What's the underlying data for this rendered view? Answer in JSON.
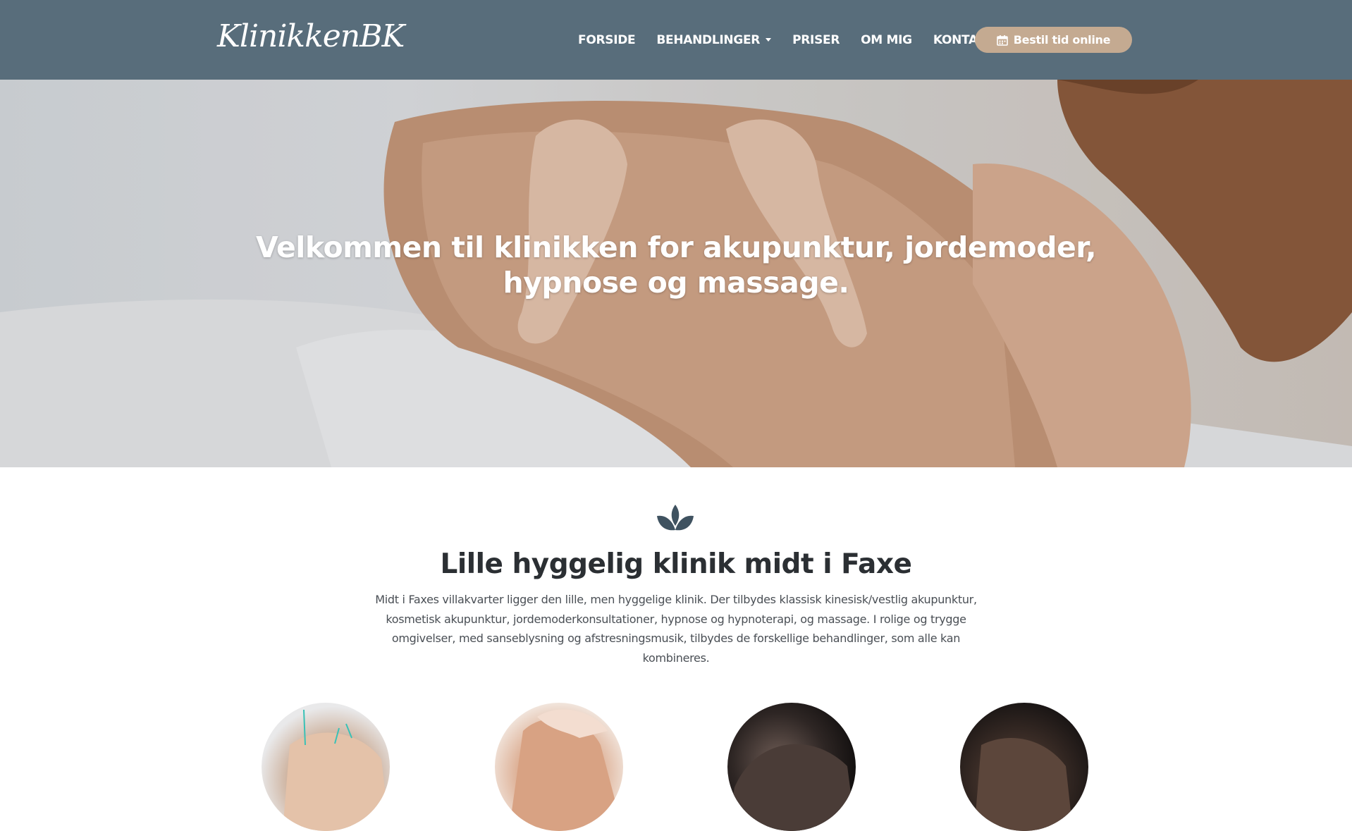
{
  "brand": {
    "logo_text": "KlinikkenBK"
  },
  "nav": {
    "items": [
      {
        "label": "FORSIDE"
      },
      {
        "label": "BEHANDLINGER",
        "has_dropdown": true
      },
      {
        "label": "PRISER"
      },
      {
        "label": "OM MIG"
      },
      {
        "label": "KONTAKT"
      }
    ],
    "cta_label": "Bestil tid online",
    "cta_icon": "calendar-icon"
  },
  "hero": {
    "title": "Velkommen til klinikken for akupunktur, jordemoder, hypnose og massage."
  },
  "intro": {
    "icon": "lotus-icon",
    "heading": "Lille hyggelig klinik midt i Faxe",
    "text": "Midt i Faxes villakvarter ligger den lille, men hyggelige klinik. Der tilbydes klassisk kinesisk/vestlig akupunktur, kosmetisk akupunktur, jordemoderkonsultationer, hypnose og hypnoterapi, og massage. I rolige og trygge omgivelser, med sanseblysning og afstresningsmusik, tilbydes de forskellige behandlinger, som alle kan kombineres."
  },
  "colors": {
    "navbar": "#586d7b",
    "cta": "#c4aa91",
    "accent_dark": "#3f5260"
  }
}
